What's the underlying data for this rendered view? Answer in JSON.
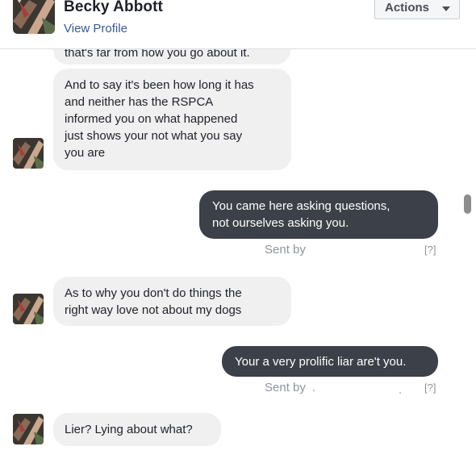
{
  "header": {
    "name": "Becky Abbott",
    "view_profile": "View Profile",
    "actions_label": "Actions",
    "actions_icon": "caret-down-icon"
  },
  "messages": [
    {
      "direction": "incoming",
      "text": "that's far from how you go about it."
    },
    {
      "direction": "incoming",
      "lines": [
        "And to say it's been how long it has",
        "and neither has the RSPCA",
        "informed you on what happened",
        "just shows your not what you say",
        "you are"
      ]
    },
    {
      "direction": "outgoing",
      "lines": [
        "You came here asking questions,",
        "not ourselves asking you."
      ],
      "sent_by": "Sent by",
      "help": "[?]"
    },
    {
      "direction": "incoming",
      "lines": [
        "As to why you don't do things the",
        "right way love not about my dogs"
      ]
    },
    {
      "direction": "outgoing",
      "text": "Your a very prolific liar are't you.",
      "sent_by": "Sent by",
      "help": "[?]"
    },
    {
      "direction": "incoming",
      "text": "Lier? Lying about what?"
    }
  ],
  "colors": {
    "incoming_bubble": "#f1f0f0",
    "outgoing_bubble": "#3c4048",
    "link": "#385898",
    "muted": "#90949c"
  }
}
